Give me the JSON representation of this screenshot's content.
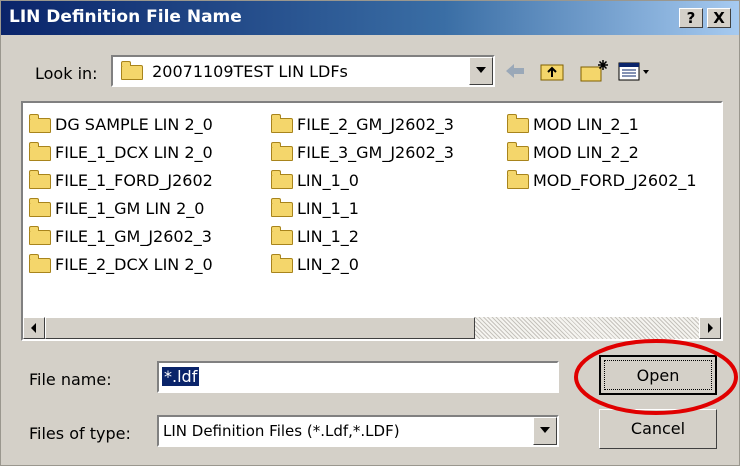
{
  "window": {
    "title": "LIN Definition File Name",
    "help_label": "?",
    "close_label": "X"
  },
  "look_in": {
    "label": "Look in:",
    "value": "20071109TEST LIN LDFs",
    "toolbar_icons": [
      "back-arrow-icon",
      "up-folder-icon",
      "new-folder-icon",
      "view-menu-icon"
    ]
  },
  "file_list": {
    "columns": [
      [
        "DG SAMPLE LIN 2_0",
        "FILE_1_DCX LIN 2_0",
        "FILE_1_FORD_J2602",
        "FILE_1_GM LIN 2_0",
        "FILE_1_GM_J2602_3",
        "FILE_2_DCX LIN 2_0"
      ],
      [
        "FILE_2_GM_J2602_3",
        "FILE_3_GM_J2602_3",
        "LIN_1_0",
        "LIN_1_1",
        "LIN_1_2",
        "LIN_2_0"
      ],
      [
        "MOD LIN_2_1",
        "MOD LIN_2_2",
        "MOD_FORD_J2602_1"
      ]
    ]
  },
  "file_name": {
    "label": "File name:",
    "value": "*.ldf"
  },
  "files_of_type": {
    "label": "Files of type:",
    "value": "LIN Definition Files (*.Ldf,*.LDF)"
  },
  "buttons": {
    "open": "Open",
    "cancel": "Cancel"
  },
  "colors": {
    "title_bar": "#0a246a",
    "face": "#d4d0c8",
    "highlight": "#e00000"
  }
}
